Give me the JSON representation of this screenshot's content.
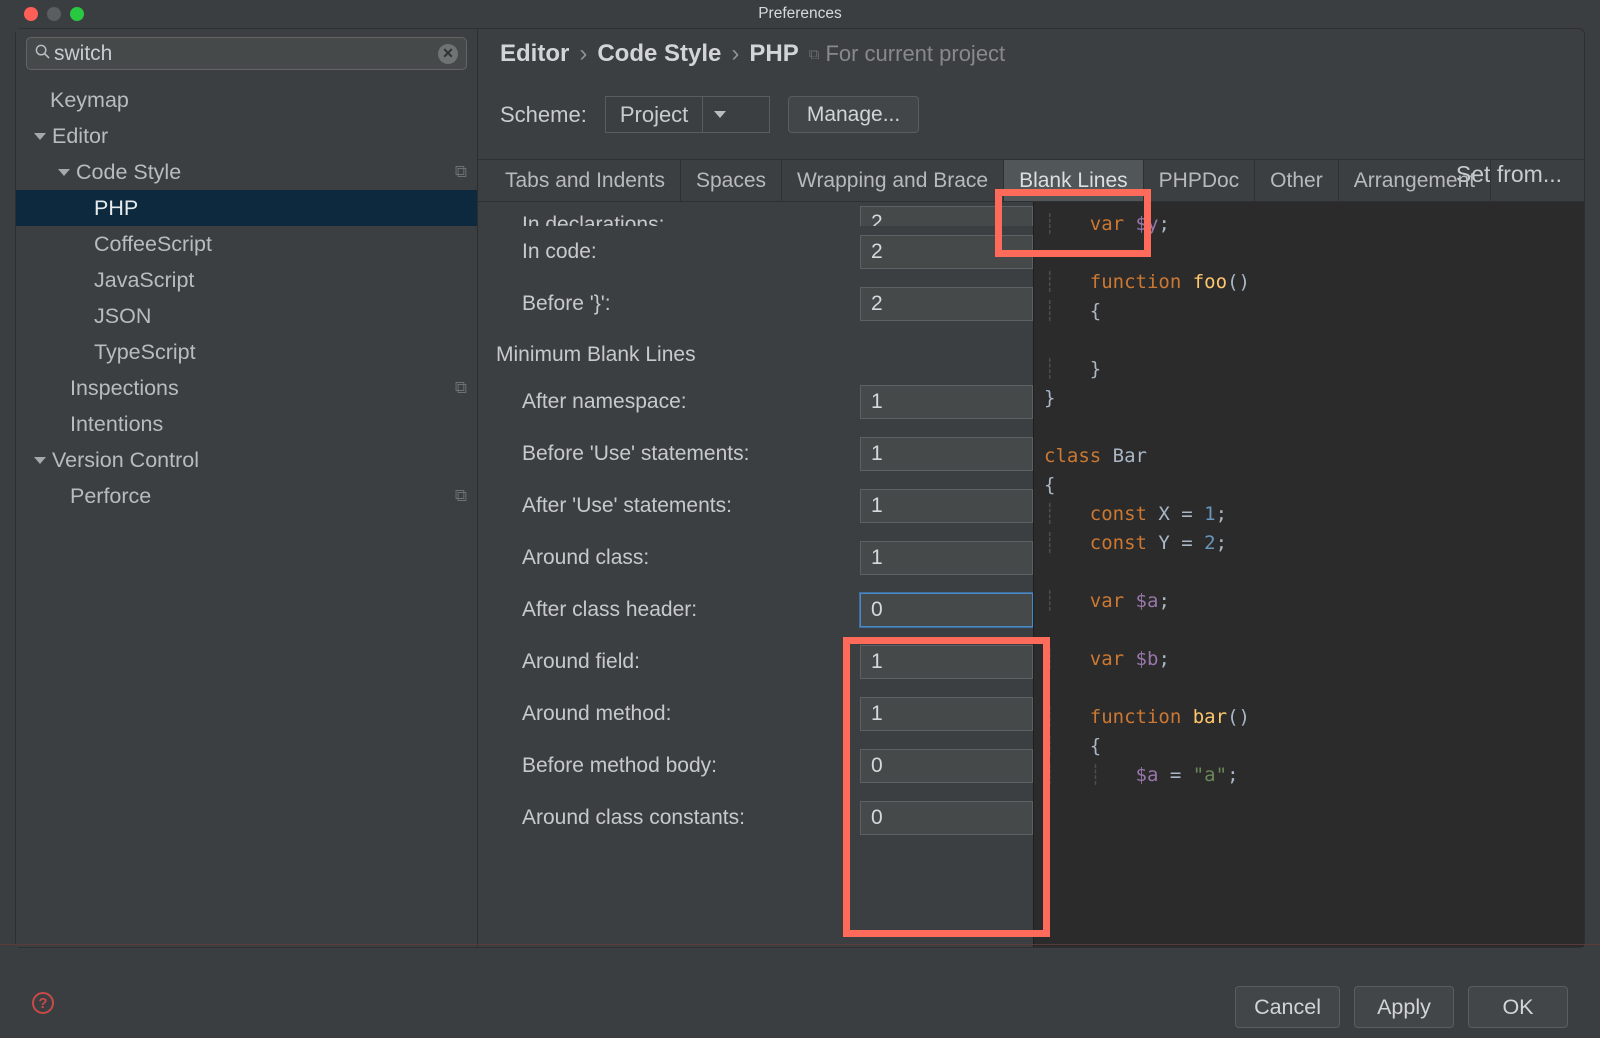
{
  "window_title": "Preferences",
  "search_value": "switch",
  "sidebar": {
    "items": [
      {
        "label": "Keymap",
        "indent": 34,
        "chevron": ""
      },
      {
        "label": "Editor",
        "indent": 18,
        "chevron": "down"
      },
      {
        "label": "Code Style",
        "indent": 42,
        "chevron": "down",
        "copy": true
      },
      {
        "label": "PHP",
        "indent": 78,
        "chevron": "",
        "selected": true
      },
      {
        "label": "CoffeeScript",
        "indent": 78,
        "chevron": ""
      },
      {
        "label": "JavaScript",
        "indent": 78,
        "chevron": ""
      },
      {
        "label": "JSON",
        "indent": 78,
        "chevron": ""
      },
      {
        "label": "TypeScript",
        "indent": 78,
        "chevron": ""
      },
      {
        "label": "Inspections",
        "indent": 54,
        "chevron": "",
        "copy": true
      },
      {
        "label": "Intentions",
        "indent": 54,
        "chevron": ""
      },
      {
        "label": "Version Control",
        "indent": 18,
        "chevron": "down"
      },
      {
        "label": "Perforce",
        "indent": 54,
        "chevron": "",
        "copy": true
      }
    ]
  },
  "breadcrumb": [
    "Editor",
    "Code Style",
    "PHP"
  ],
  "breadcrumb_hint": "For current project",
  "scheme": {
    "label": "Scheme:",
    "value": "Project",
    "manage": "Manage..."
  },
  "set_from": "Set from...",
  "tabs": [
    "Tabs and Indents",
    "Spaces",
    "Wrapping and Brace",
    "Blank Lines",
    "PHPDoc",
    "Other",
    "Arrangement"
  ],
  "active_tab": 3,
  "top_truncated": "In declarations:",
  "top_rows": [
    {
      "label": "In code:",
      "value": "2"
    },
    {
      "label": "Before '}':",
      "value": "2"
    }
  ],
  "section_title": "Minimum Blank Lines",
  "min_rows": [
    {
      "label": "After namespace:",
      "value": "1"
    },
    {
      "label": "Before 'Use' statements:",
      "value": "1"
    },
    {
      "label": "After 'Use' statements:",
      "value": "1"
    },
    {
      "label": "Around class:",
      "value": "1"
    },
    {
      "label": "After class header:",
      "value": "0",
      "focused": true
    },
    {
      "label": "Around field:",
      "value": "1"
    },
    {
      "label": "Around method:",
      "value": "1"
    },
    {
      "label": "Before method body:",
      "value": "0"
    },
    {
      "label": "Around class constants:",
      "value": "0"
    }
  ],
  "preview": {
    "lines": [
      [
        [
          "indent",
          "    "
        ],
        [
          "kw",
          "var"
        ],
        [
          "plain",
          " "
        ],
        [
          "var",
          "$y"
        ],
        [
          "plain",
          ";"
        ]
      ],
      [
        [
          "plain",
          ""
        ]
      ],
      [
        [
          "indent",
          "    "
        ],
        [
          "kw",
          "function"
        ],
        [
          "plain",
          " "
        ],
        [
          "fn",
          "foo"
        ],
        [
          "plain",
          "()"
        ]
      ],
      [
        [
          "indent",
          "    "
        ],
        [
          "plain",
          "{"
        ]
      ],
      [
        [
          "plain",
          ""
        ]
      ],
      [
        [
          "indent",
          "    "
        ],
        [
          "plain",
          "}"
        ]
      ],
      [
        [
          "plain",
          "}"
        ]
      ],
      [
        [
          "plain",
          ""
        ]
      ],
      [
        [
          "kw",
          "class"
        ],
        [
          "plain",
          " Bar"
        ]
      ],
      [
        [
          "plain",
          "{"
        ]
      ],
      [
        [
          "indent",
          "    "
        ],
        [
          "kw",
          "const"
        ],
        [
          "plain",
          " X = "
        ],
        [
          "num",
          "1"
        ],
        [
          "plain",
          ";"
        ]
      ],
      [
        [
          "indent",
          "    "
        ],
        [
          "kw",
          "const"
        ],
        [
          "plain",
          " Y = "
        ],
        [
          "num",
          "2"
        ],
        [
          "plain",
          ";"
        ]
      ],
      [
        [
          "plain",
          ""
        ]
      ],
      [
        [
          "indent",
          "    "
        ],
        [
          "kw",
          "var"
        ],
        [
          "plain",
          " "
        ],
        [
          "var",
          "$a"
        ],
        [
          "plain",
          ";"
        ]
      ],
      [
        [
          "plain",
          ""
        ]
      ],
      [
        [
          "indent",
          "    "
        ],
        [
          "kw",
          "var"
        ],
        [
          "plain",
          " "
        ],
        [
          "var",
          "$b"
        ],
        [
          "plain",
          ";"
        ]
      ],
      [
        [
          "plain",
          ""
        ]
      ],
      [
        [
          "indent",
          "    "
        ],
        [
          "kw",
          "function"
        ],
        [
          "plain",
          " "
        ],
        [
          "fn",
          "bar"
        ],
        [
          "plain",
          "()"
        ]
      ],
      [
        [
          "indent",
          "    "
        ],
        [
          "plain",
          "{"
        ]
      ],
      [
        [
          "indent",
          "        "
        ],
        [
          "var",
          "$a"
        ],
        [
          "plain",
          " = "
        ],
        [
          "str",
          "\"a\""
        ],
        [
          "plain",
          ";"
        ]
      ]
    ]
  },
  "footer": {
    "cancel": "Cancel",
    "apply": "Apply",
    "ok": "OK"
  }
}
